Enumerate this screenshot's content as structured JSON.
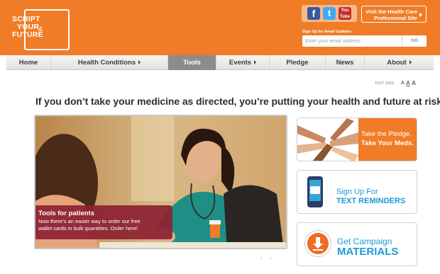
{
  "colors": {
    "brand_orange": "#f07c27",
    "nav_active": "#8c8c8c",
    "caption_bg": "#8c2132",
    "link_blue": "#1b9ad4"
  },
  "header": {
    "logo": {
      "line1": "SCRIPT",
      "line2": "YOUR",
      "line3": "FUTURE",
      "amp": "&"
    },
    "social": [
      {
        "name": "facebook-icon",
        "glyph": "f"
      },
      {
        "name": "twitter-icon",
        "glyph": "t"
      },
      {
        "name": "youtube-icon",
        "glyph": "You Tube"
      }
    ],
    "pro_site_label": "Visit the Health Care Professional Site",
    "email_label": "Sign Up for Email Updates",
    "email_placeholder": "Enter your email address",
    "go_label": "GO"
  },
  "nav": {
    "items": [
      {
        "label": "Home",
        "has_submenu": false,
        "active": false
      },
      {
        "label": "Health Conditions",
        "has_submenu": true,
        "active": false
      },
      {
        "label": "Tools",
        "has_submenu": false,
        "active": true
      },
      {
        "label": "Events",
        "has_submenu": true,
        "active": false
      },
      {
        "label": "Pledge",
        "has_submenu": false,
        "active": false
      },
      {
        "label": "News",
        "has_submenu": false,
        "active": false
      },
      {
        "label": "About",
        "has_submenu": true,
        "active": false
      }
    ]
  },
  "text_size": {
    "label": "TEXT SIZE:",
    "small": "A",
    "medium": "A",
    "large": "A"
  },
  "headline": "If you don’t take your medicine as directed, you’re putting your health and future at risk.",
  "hero": {
    "caption_title": "Tools for patients",
    "caption_line1": "Now there’s an easier way to order our free",
    "caption_line2": "wallet cards in bulk quantities. Order here!",
    "prev": "‹",
    "next": "›"
  },
  "cards": {
    "pledge": {
      "line1": "Take the Pledge.",
      "line2": "Take Your Meds."
    },
    "text_reminders": {
      "line1": "Sign Up For",
      "line2": "TEXT REMINDERS"
    },
    "materials": {
      "line1": "Get Campaign",
      "line2": "MATERIALS"
    }
  }
}
